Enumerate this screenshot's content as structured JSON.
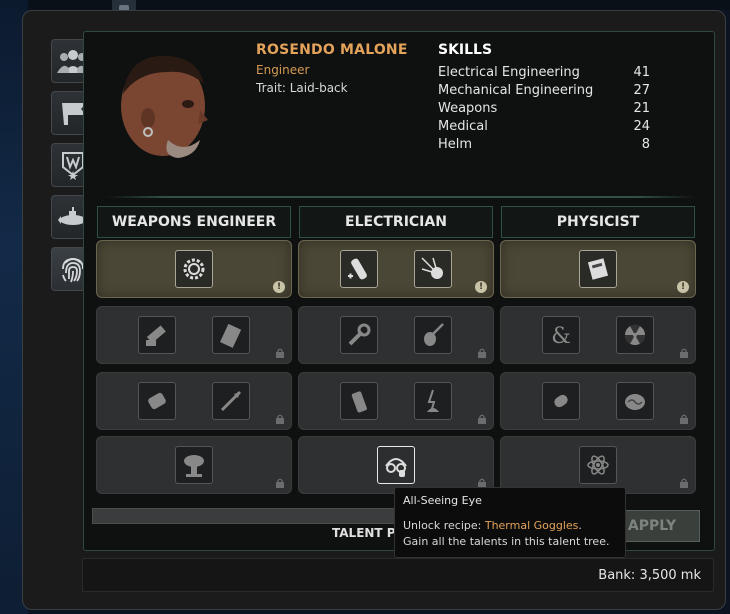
{
  "character": {
    "name": "ROSENDO MALONE",
    "job": "Engineer",
    "trait": "Trait: Laid-back"
  },
  "skills": {
    "title": "SKILLS",
    "items": [
      {
        "name": "Electrical Engineering",
        "value": "41"
      },
      {
        "name": "Mechanical Engineering",
        "value": "27"
      },
      {
        "name": "Weapons",
        "value": "21"
      },
      {
        "name": "Medical",
        "value": "24"
      },
      {
        "name": "Helm",
        "value": "8"
      }
    ]
  },
  "sidebar": {
    "tabs": [
      {
        "icon": "crew-icon",
        "badge": ""
      },
      {
        "icon": "mission-flag-icon",
        "badge": ""
      },
      {
        "icon": "reputation-icon",
        "badge": ""
      },
      {
        "icon": "submarine-icon",
        "badge": ""
      },
      {
        "icon": "fingerprint-icon",
        "badge": "!"
      }
    ]
  },
  "trees": [
    {
      "name": "WEAPONS ENGINEER"
    },
    {
      "name": "ELECTRICIAN"
    },
    {
      "name": "PHYSICIST"
    }
  ],
  "talent_rows": [
    {
      "state": "unlockable",
      "badge": "!"
    },
    {
      "state": "locked",
      "badge": ""
    },
    {
      "state": "locked",
      "badge": ""
    },
    {
      "state": "locked",
      "badge": ""
    }
  ],
  "talent_points_label": "TALENT PO",
  "apply_button": "APPLY",
  "bank": "Bank: 3,500 mk",
  "tooltip": {
    "title": "All-Seeing Eye",
    "desc1_prefix": "Unlock recipe: ",
    "desc1_accent": "Thermal Goggles",
    "desc1_suffix": ".",
    "desc2": "Gain all the talents in this talent tree."
  },
  "colors": {
    "accent": "#e3a35a",
    "badge": "#e3a12b",
    "tree_border": "#2e5046"
  }
}
